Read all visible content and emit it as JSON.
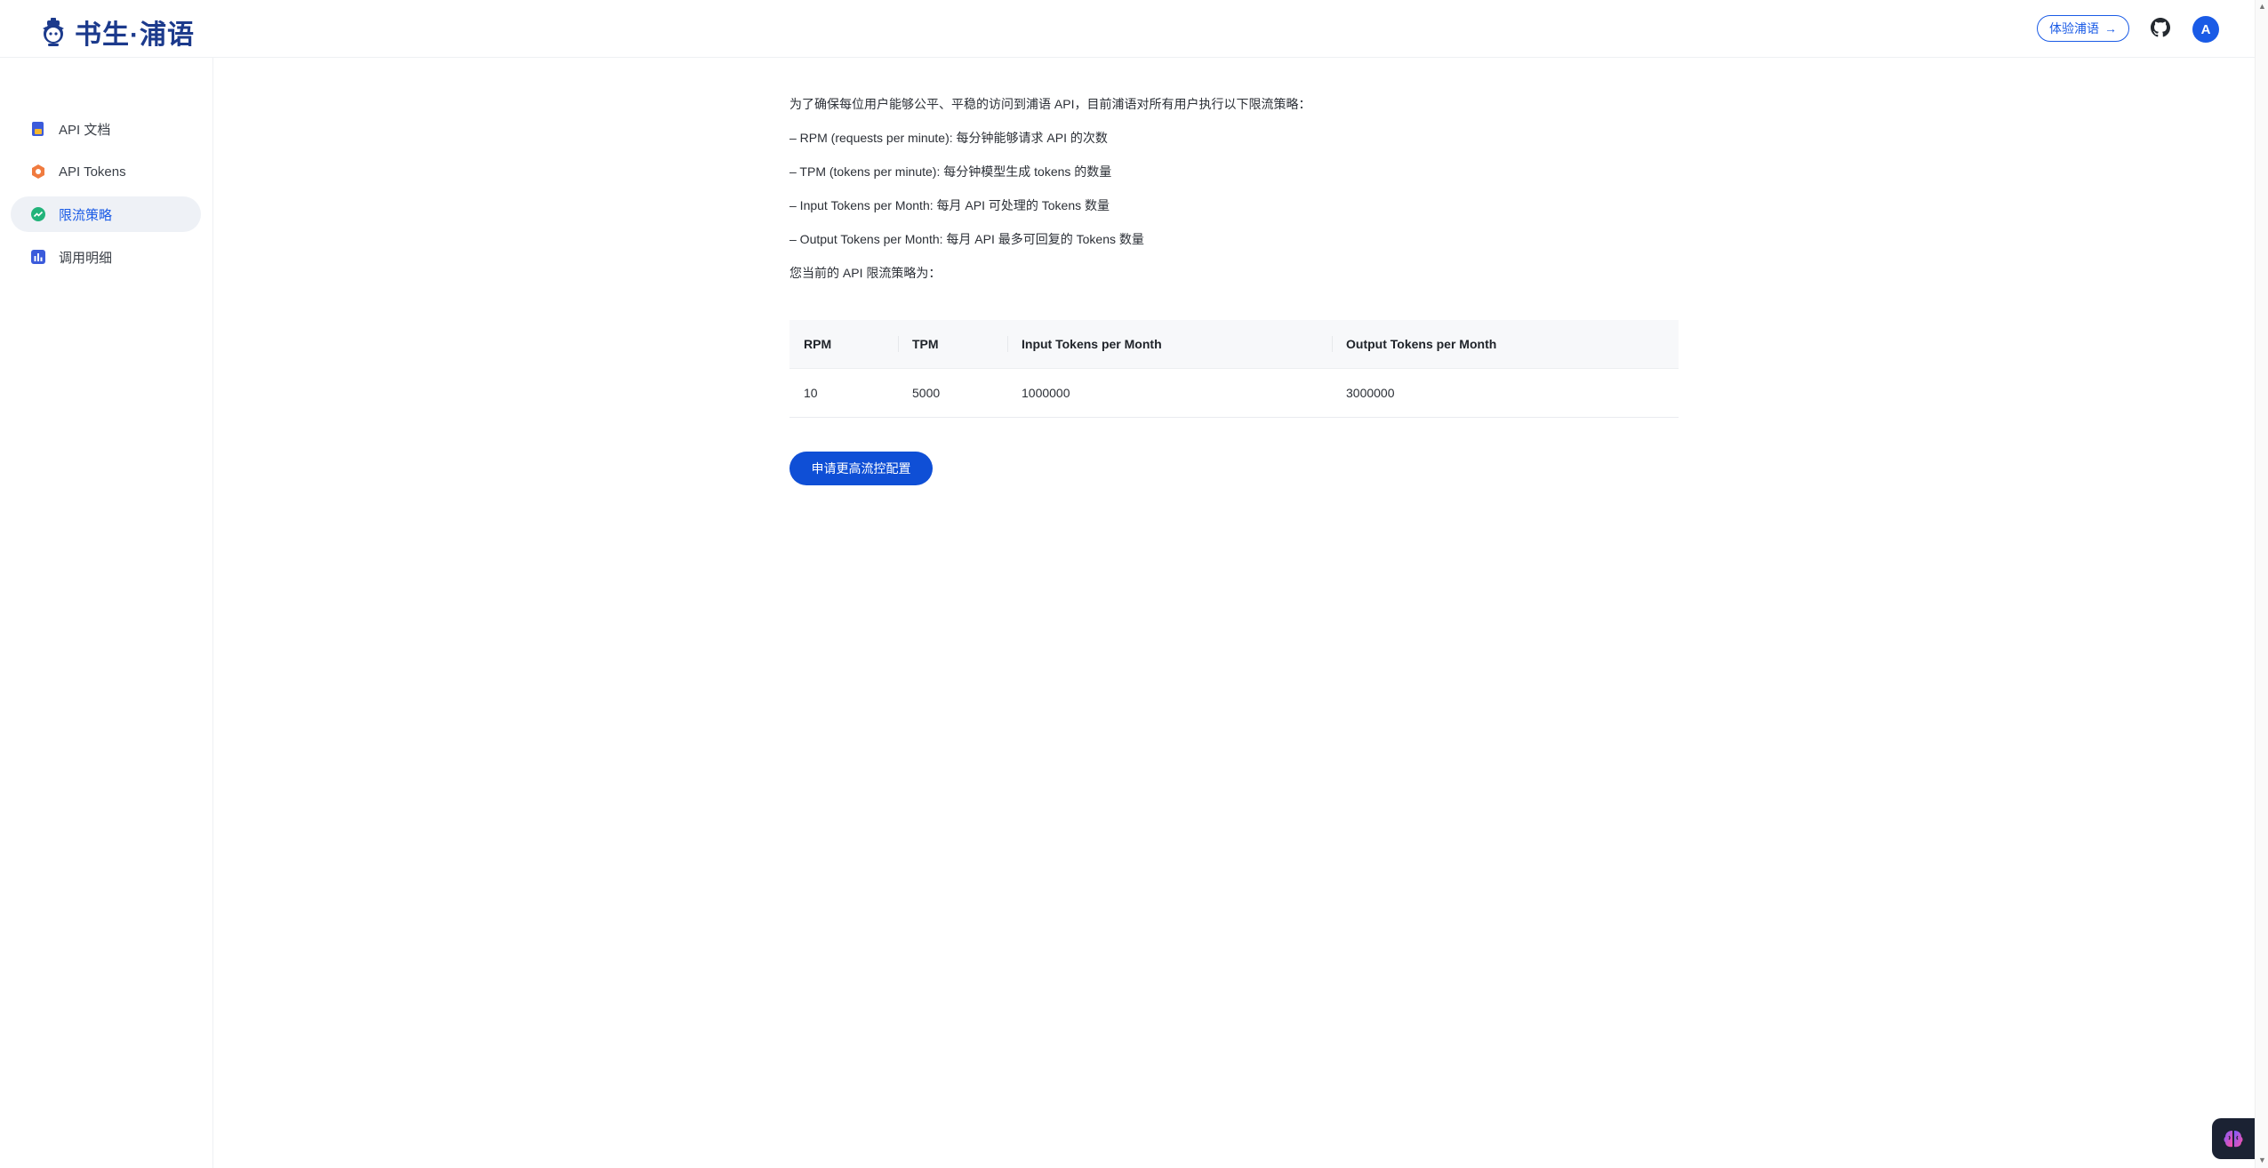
{
  "header": {
    "logo_text": "书生·浦语",
    "try_button": "体验浦语",
    "try_arrow": "→",
    "avatar_initial": "A"
  },
  "sidebar": {
    "items": [
      {
        "label": "API 文档",
        "icon": "doc-icon",
        "active": false
      },
      {
        "label": "API Tokens",
        "icon": "hexagon-icon",
        "active": false
      },
      {
        "label": "限流策略",
        "icon": "trend-icon",
        "active": true
      },
      {
        "label": "调用明细",
        "icon": "bar-chart-icon",
        "active": false
      }
    ]
  },
  "main": {
    "intro": "为了确保每位用户能够公平、平稳的访问到浦语 API，目前浦语对所有用户执行以下限流策略：",
    "rules": [
      "– RPM (requests per minute): 每分钟能够请求 API 的次数",
      "– TPM (tokens per minute): 每分钟模型生成 tokens 的数量",
      "– Input Tokens per Month: 每月 API 可处理的 Tokens 数量",
      "– Output Tokens per Month: 每月 API 最多可回复的 Tokens 数量"
    ],
    "current_label": "您当前的 API 限流策略为：",
    "table": {
      "headers": [
        "RPM",
        "TPM",
        "Input Tokens per Month",
        "Output Tokens per Month"
      ],
      "rows": [
        [
          "10",
          "5000",
          "1000000",
          "3000000"
        ]
      ]
    },
    "apply_button": "申请更高流控配置"
  },
  "colors": {
    "accent": "#1a5be6",
    "button": "#0f4fd6",
    "active_bg": "#eef1f6",
    "logo": "#1c3a8c"
  }
}
